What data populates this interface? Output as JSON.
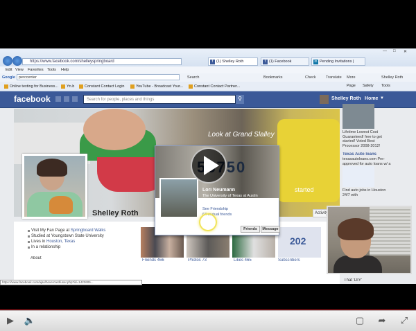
{
  "browser": {
    "address_url": "https://www.facebook.com/shelleyspringboard",
    "tabs": [
      {
        "label": "(1) Shelley Roth"
      },
      {
        "label": "(1) Facebook"
      },
      {
        "label": "Pending Invitations |"
      }
    ],
    "menu": [
      "Edit",
      "View",
      "Favorites",
      "Tools",
      "Help"
    ],
    "google_box_label": "Google",
    "google_query": "perccenter",
    "search_label": "Search",
    "bookmarks_label": "Bookmarks",
    "check_label": "Check",
    "translate_label": "Translate",
    "more_label": "More",
    "signed_in_user": "Shelley Roth",
    "favorites": [
      {
        "label": "Online texting for Business..."
      },
      {
        "label": "Yn.b"
      },
      {
        "label": "Constant Contact Login"
      },
      {
        "label": "YouTube - Broadcast Your..."
      },
      {
        "label": "Constant Contact Partner..."
      }
    ],
    "toolbar": {
      "page": "Page",
      "safety": "Safety",
      "tools": "Tools"
    }
  },
  "facebook": {
    "logo": "facebook",
    "search_placeholder": "Search for people, places and things",
    "user_name": "Shelley Roth",
    "home_label": "Home",
    "cover_caption": "Look at Grand Slalley",
    "profile_name": "Shelley Roth",
    "info_items": [
      {
        "prefix": "Visit My Fan Page at ",
        "link": "Springboard Walks"
      },
      {
        "prefix": "Studied at Youngstown State University",
        "link": ""
      },
      {
        "prefix": "Lives in ",
        "link": "Houston, Texas"
      },
      {
        "prefix": "In a relationship",
        "link": ""
      }
    ],
    "about_label": "About",
    "thumb_labels": {
      "friends": "Friends 466",
      "photos": "Photos 73",
      "likes": "Likes 465",
      "subscribers": "Subscribers"
    },
    "subscribers_count": "202",
    "activity_log": "Activity Log",
    "started_text": "started",
    "hovercard": {
      "plate_number": "58750",
      "name": "Lori Neumann",
      "school": "The University of Texas at Austin",
      "friendship": "See Friendship",
      "mutual": "64 mutual friends",
      "friends_button": "Friends",
      "message_button": "Message"
    },
    "ads": [
      {
        "title": "",
        "text": "Lifetime Lowest Cost Guaranteed! free to get started! Voted Best Processor 2008-2012!"
      },
      {
        "title": "Texas Auto loans",
        "text": "texasautoloans.com Pre-approved for auto loans w/ a low rate"
      },
      {
        "title": "",
        "text": "Find auto jobs in Houston 24/7 with"
      }
    ],
    "that_label": "That 'DIY'",
    "status_url": "https://www.facebook.com/ajax/hovercard/user.php?id=1422606..."
  },
  "player": {
    "progress": 0.0
  },
  "colors": {
    "fb_blue": "#3b5998",
    "progress_red": "#cc181e"
  }
}
